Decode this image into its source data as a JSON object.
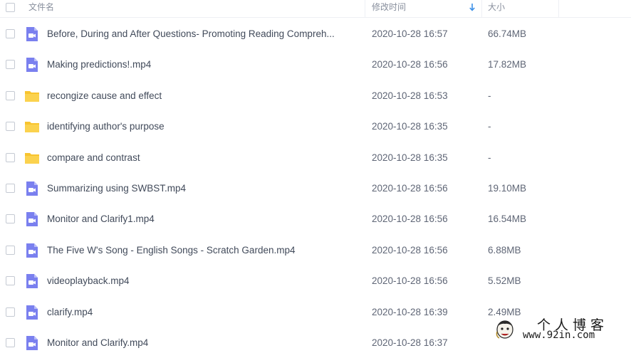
{
  "header": {
    "name_label": "文件名",
    "time_label": "修改时间",
    "size_label": "大小",
    "sort_icon": "sort-down-arrow-icon"
  },
  "colors": {
    "video_icon": "#7a80ef",
    "folder_icon": "#f8c42f",
    "sort_arrow": "#3b8fe8"
  },
  "files": [
    {
      "type": "video",
      "name": "Before, During and After Questions- Promoting Reading Compreh...",
      "time": "2020-10-28 16:57",
      "size": "66.74MB"
    },
    {
      "type": "video",
      "name": "Making predictions!.mp4",
      "time": "2020-10-28 16:56",
      "size": "17.82MB"
    },
    {
      "type": "folder",
      "name": "recongize cause and effect",
      "time": "2020-10-28 16:53",
      "size": "-"
    },
    {
      "type": "folder",
      "name": "identifying author's purpose",
      "time": "2020-10-28 16:35",
      "size": "-"
    },
    {
      "type": "folder",
      "name": "compare and contrast",
      "time": "2020-10-28 16:35",
      "size": "-"
    },
    {
      "type": "video",
      "name": "Summarizing using SWBST.mp4",
      "time": "2020-10-28 16:56",
      "size": "19.10MB"
    },
    {
      "type": "video",
      "name": "Monitor and Clarify1.mp4",
      "time": "2020-10-28 16:56",
      "size": "16.54MB"
    },
    {
      "type": "video",
      "name": "The Five W's Song - English Songs - Scratch Garden.mp4",
      "time": "2020-10-28 16:56",
      "size": "6.88MB"
    },
    {
      "type": "video",
      "name": "videoplayback.mp4",
      "time": "2020-10-28 16:56",
      "size": "5.52MB"
    },
    {
      "type": "video",
      "name": "clarify.mp4",
      "time": "2020-10-28 16:39",
      "size": "2.49MB"
    },
    {
      "type": "video",
      "name": "Monitor and Clarify.mp4",
      "time": "2020-10-28 16:37",
      "size": ""
    }
  ],
  "watermark": {
    "title": "个人博客",
    "url": "www.92in.com"
  }
}
